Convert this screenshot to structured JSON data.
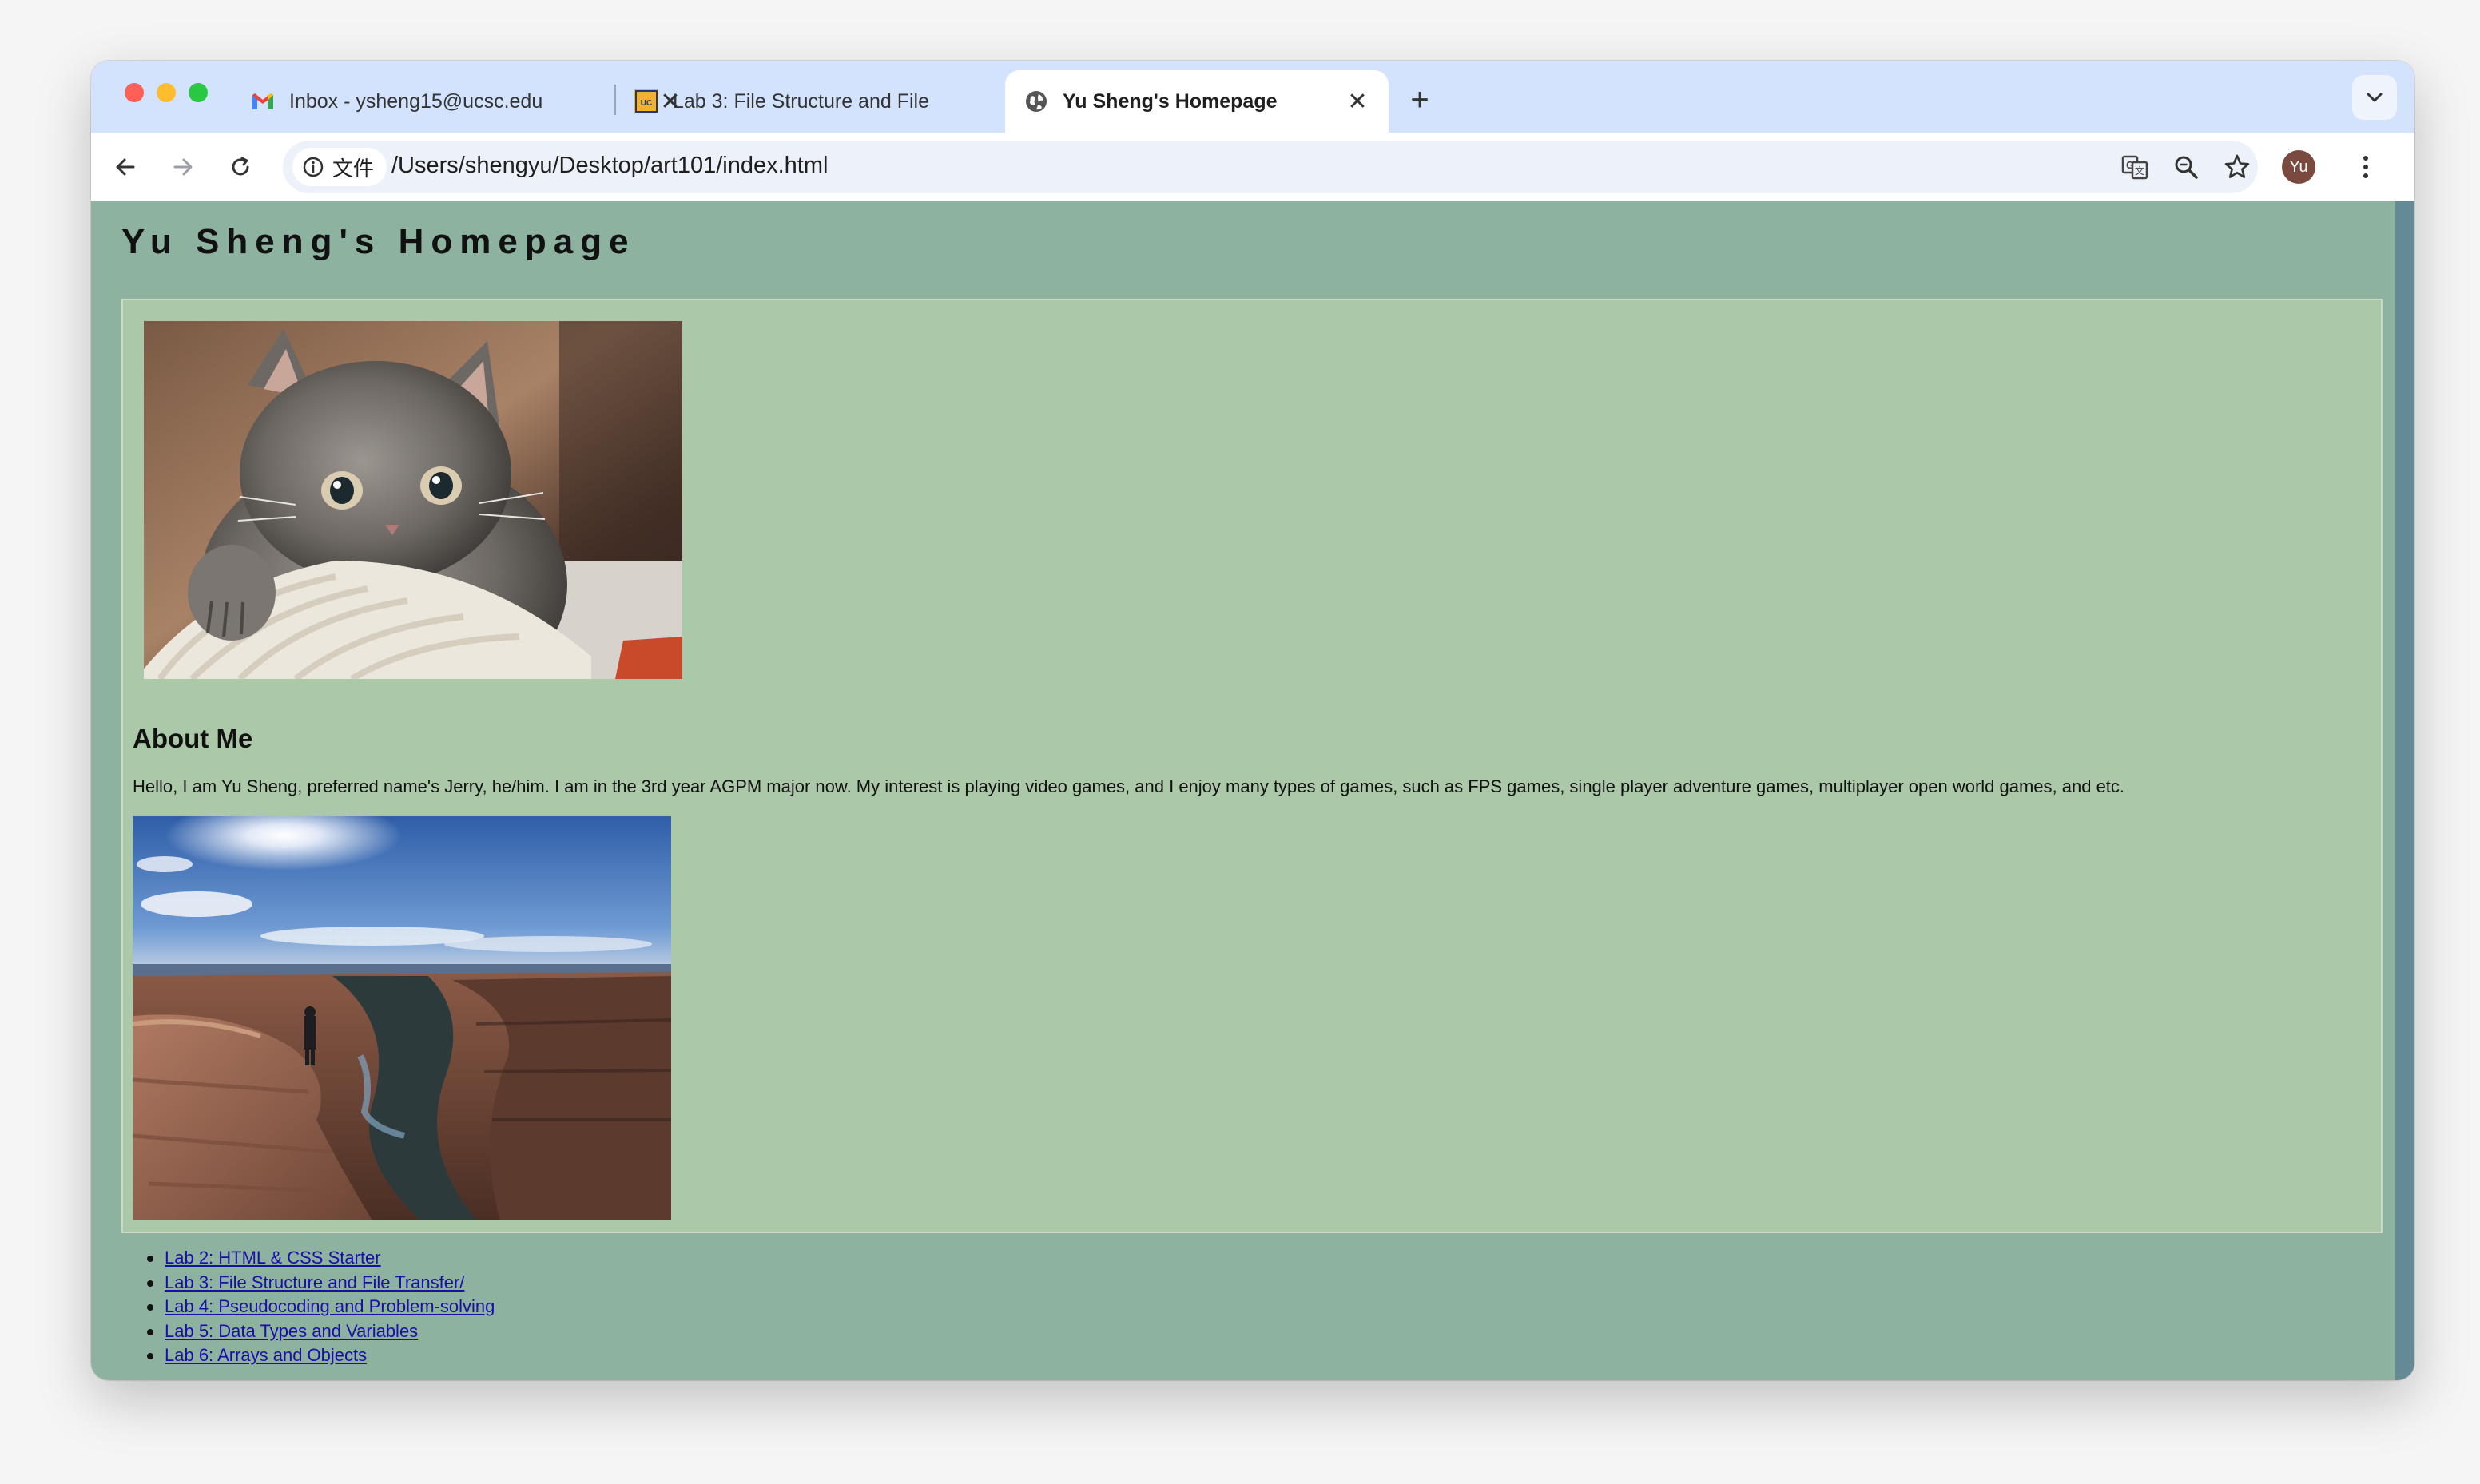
{
  "browser": {
    "tabs": [
      {
        "title": "Inbox - ysheng15@ucsc.edu",
        "favicon": "gmail-icon",
        "active": false
      },
      {
        "title": "Lab 3: File Structure and File",
        "favicon": "ucsc-icon",
        "active": false
      },
      {
        "title": "Yu Sheng's Homepage",
        "favicon": "globe-icon",
        "active": true
      }
    ],
    "address_bar": {
      "chip_label": "文件",
      "url": "/Users/shengyu/Desktop/art101/index.html"
    },
    "profile_initials": "Yu"
  },
  "page": {
    "title": "Yu Sheng's Homepage",
    "about_heading": "About Me",
    "about_text": "Hello, I am Yu Sheng, preferred name's Jerry, he/him. I am in the 3rd year AGPM major now. My interest is playing video games, and I enjoy many types of games, such as FPS games, single player adventure games, multiplayer open world games, and etc.",
    "labs": [
      "Lab 2: HTML & CSS Starter",
      "Lab 3: File Structure and File Transfer/",
      "Lab 4: Pseudocoding and Problem-solving",
      "Lab 5: Data Types and Variables",
      "Lab 6: Arrays and Objects"
    ]
  },
  "colors": {
    "page_background": "#8db3a0",
    "content_background": "#abc8a8",
    "scrollbar": "#648a96",
    "link": "#1a0dab"
  }
}
